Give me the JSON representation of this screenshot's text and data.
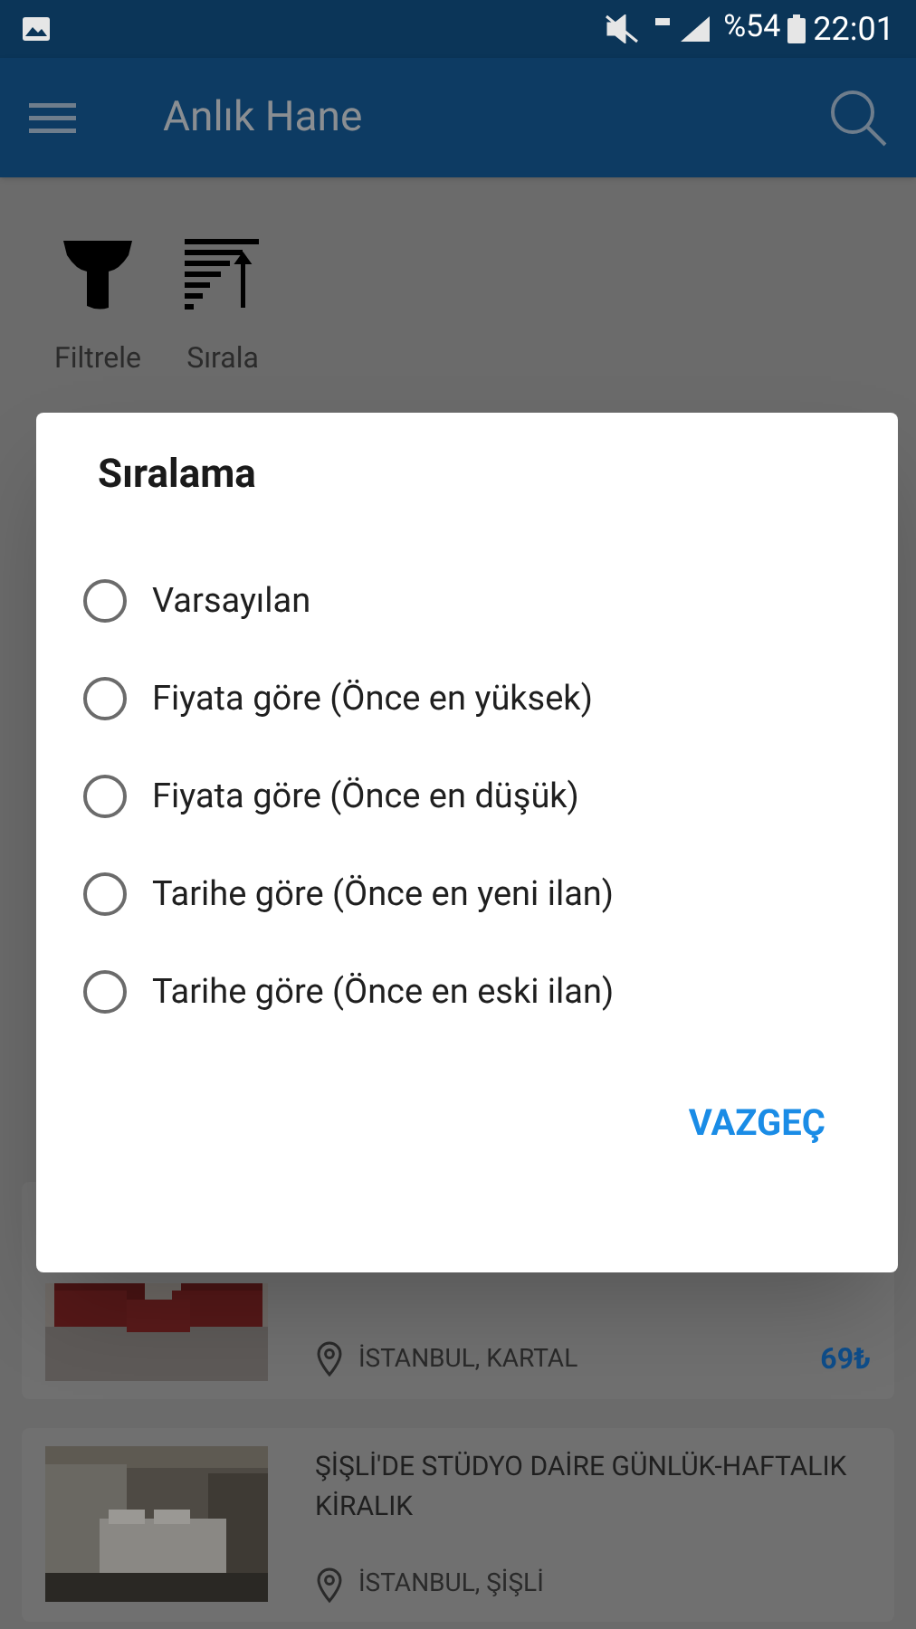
{
  "status_bar": {
    "battery": "%54",
    "time": "22:01"
  },
  "app_bar": {
    "title": "Anlık Hane"
  },
  "toolbar": [
    {
      "kind": "filter",
      "label": "Filtrele"
    },
    {
      "kind": "sort",
      "label": "Sırala"
    }
  ],
  "listings": [
    {
      "location": "İSTANBUL, KARTAL",
      "price": "69₺"
    },
    {
      "title": "ŞİŞLİ'DE STÜDYO DAİRE GÜNLÜK-HAFTALIK KİRALIK",
      "location": "İSTANBUL, ŞİŞLİ"
    }
  ],
  "dialog": {
    "title": "Sıralama",
    "options": [
      {
        "label": "Varsayılan",
        "selected": false
      },
      {
        "label": "Fiyata göre (Önce en yüksek)",
        "selected": false
      },
      {
        "label": "Fiyata göre (Önce en düşük)",
        "selected": false
      },
      {
        "label": "Tarihe göre (Önce en yeni ilan)",
        "selected": false
      },
      {
        "label": "Tarihe göre (Önce en eski ilan)",
        "selected": false
      }
    ],
    "button": "VAZGEÇ"
  }
}
